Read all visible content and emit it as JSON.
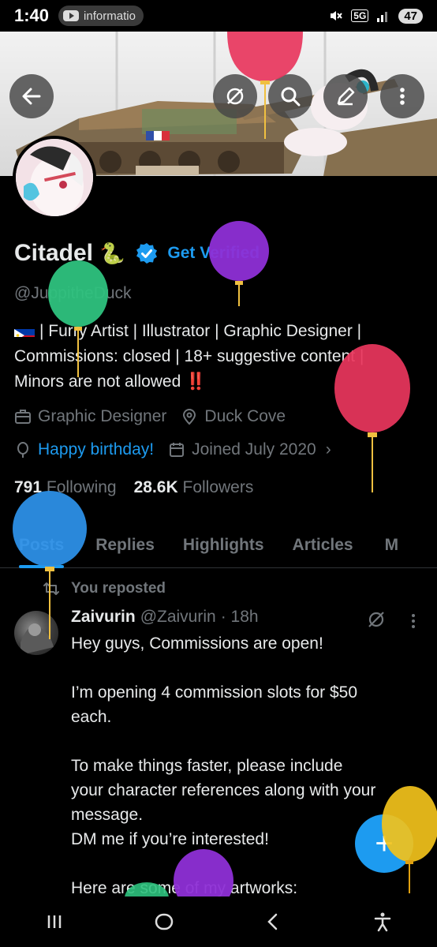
{
  "status": {
    "time": "1:40",
    "notification": "informatio",
    "network": "5G",
    "battery": "47"
  },
  "profile": {
    "name": "Citadel",
    "name_emoji": "🐍",
    "get_verified": "Get Verified",
    "handle": "@JuppitheDuck",
    "bio_line1": "| Furry Artist | Illustrator | Graphic Designer |",
    "bio_line2": "Commissions: closed | 18+ suggestive content |",
    "bio_line3": "Minors are not allowed",
    "bio_emoji": "‼️",
    "profession": "Graphic Designer",
    "location": "Duck Cove",
    "birthday": "Happy birthday!",
    "joined": "Joined July 2020",
    "following_count": "791",
    "following_label": "Following",
    "followers_count": "28.6K",
    "followers_label": "Followers"
  },
  "tabs": [
    "Posts",
    "Replies",
    "Highlights",
    "Articles",
    "M"
  ],
  "active_tab": "Posts",
  "post": {
    "repost_label": "You reposted",
    "author_name": "Zaivurin",
    "author_handle": "@Zaivurin",
    "time": "· 18h",
    "text_1": "Hey guys, Commissions are open!",
    "text_2": "I’m opening 4 commission slots for $50",
    "text_3": "each.",
    "text_4": "To make things faster, please include",
    "text_5": "your character references along with your",
    "text_6": "message.",
    "text_7": "DM me if you’re interested!",
    "text_8": "Here are some of my artworks:"
  },
  "fab_label": "+",
  "colors": {
    "accent": "#1d9bf0",
    "muted": "#71767b",
    "text": "#e7e9ea",
    "balloon_pink": "#e8365d",
    "balloon_green": "#2ec27e",
    "balloon_purple": "#8e2fd6",
    "balloon_blue": "#2c8fe6",
    "balloon_yellow": "#f2c21b"
  }
}
